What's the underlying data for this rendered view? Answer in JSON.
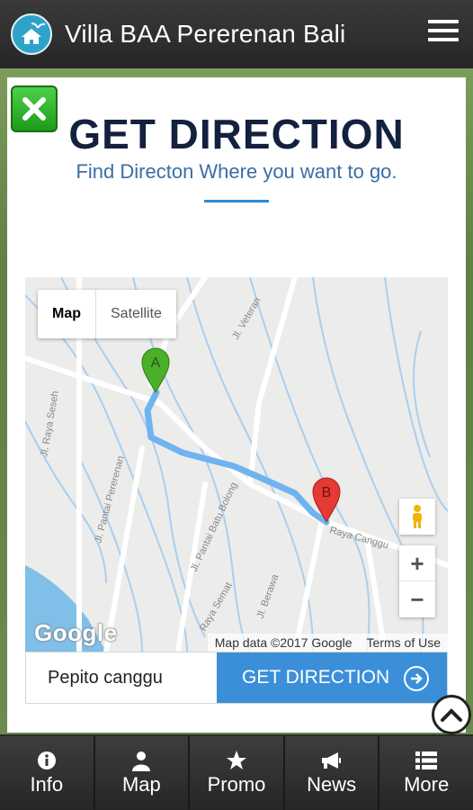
{
  "header": {
    "title": "Villa BAA Pererenan Bali"
  },
  "modal": {
    "title": "GET DIRECTION",
    "subtitle": "Find Directon Where you want to go."
  },
  "map": {
    "type_control": {
      "map": "Map",
      "satellite": "Satellite"
    },
    "marker_a": "A",
    "marker_b": "B",
    "roads": [
      "Jl. Veteran",
      "Jl. Raya Seseh",
      "Jl. Pantai Pererenan",
      "Jl. Pantai Batu Bolong",
      "Raya Canggu",
      "Raya Semat",
      "Jl. Berawa"
    ],
    "zoom_in": "+",
    "zoom_out": "−",
    "logo": "Google",
    "attribution": "Map data ©2017 Google",
    "terms": "Terms of Use"
  },
  "direction": {
    "input_value": "Pepito canggu",
    "button_label": "GET DIRECTION"
  },
  "nav": [
    {
      "label": "Info",
      "icon": "info-icon"
    },
    {
      "label": "Map",
      "icon": "person-icon"
    },
    {
      "label": "Promo",
      "icon": "star-icon"
    },
    {
      "label": "News",
      "icon": "megaphone-icon"
    },
    {
      "label": "More",
      "icon": "list-icon"
    }
  ],
  "colors": {
    "header_bg": "#2e2e2e",
    "title_navy": "#13213f",
    "subtitle_blue": "#3a6ea5",
    "button_blue": "#3b8fd9",
    "route_blue": "#6fb3f0",
    "marker_a": "#4caf2a",
    "marker_b": "#e53935",
    "close_green": "#2ebd2a"
  }
}
